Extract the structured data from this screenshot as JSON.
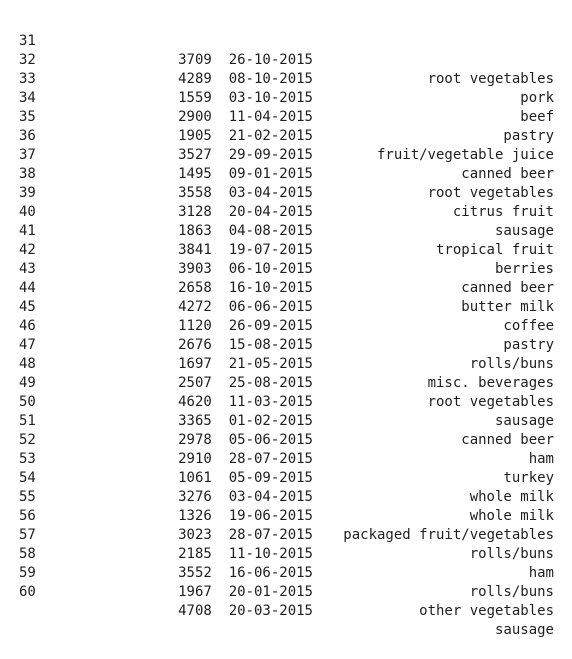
{
  "rows": [
    {
      "index": "",
      "number": "",
      "date": "",
      "item": "vegetables"
    },
    {
      "index": "31",
      "number": "3709",
      "date": "26-10-2015",
      "item": "root vegetables"
    },
    {
      "index": "32",
      "number": "4289",
      "date": "08-10-2015",
      "item": "pork"
    },
    {
      "index": "33",
      "number": "1559",
      "date": "03-10-2015",
      "item": "beef"
    },
    {
      "index": "34",
      "number": "2900",
      "date": "11-04-2015",
      "item": "pastry"
    },
    {
      "index": "35",
      "number": "1905",
      "date": "21-02-2015",
      "item": "fruit/vegetable juice"
    },
    {
      "index": "36",
      "number": "3527",
      "date": "29-09-2015",
      "item": "canned beer"
    },
    {
      "index": "37",
      "number": "1495",
      "date": "09-01-2015",
      "item": "root vegetables"
    },
    {
      "index": "38",
      "number": "3558",
      "date": "03-04-2015",
      "item": "citrus fruit"
    },
    {
      "index": "39",
      "number": "3128",
      "date": "20-04-2015",
      "item": "sausage"
    },
    {
      "index": "40",
      "number": "1863",
      "date": "04-08-2015",
      "item": "tropical fruit"
    },
    {
      "index": "41",
      "number": "3841",
      "date": "19-07-2015",
      "item": "berries"
    },
    {
      "index": "42",
      "number": "3903",
      "date": "06-10-2015",
      "item": "canned beer"
    },
    {
      "index": "43",
      "number": "2658",
      "date": "16-10-2015",
      "item": "butter milk"
    },
    {
      "index": "44",
      "number": "4272",
      "date": "06-06-2015",
      "item": "coffee"
    },
    {
      "index": "45",
      "number": "1120",
      "date": "26-09-2015",
      "item": "pastry"
    },
    {
      "index": "46",
      "number": "2676",
      "date": "15-08-2015",
      "item": "rolls/buns"
    },
    {
      "index": "47",
      "number": "1697",
      "date": "21-05-2015",
      "item": "misc. beverages"
    },
    {
      "index": "48",
      "number": "2507",
      "date": "25-08-2015",
      "item": "root vegetables"
    },
    {
      "index": "49",
      "number": "4620",
      "date": "11-03-2015",
      "item": "sausage"
    },
    {
      "index": "50",
      "number": "3365",
      "date": "01-02-2015",
      "item": "canned beer"
    },
    {
      "index": "51",
      "number": "2978",
      "date": "05-06-2015",
      "item": "ham"
    },
    {
      "index": "52",
      "number": "2910",
      "date": "28-07-2015",
      "item": "turkey"
    },
    {
      "index": "53",
      "number": "1061",
      "date": "05-09-2015",
      "item": "whole milk"
    },
    {
      "index": "54",
      "number": "3276",
      "date": "03-04-2015",
      "item": "whole milk"
    },
    {
      "index": "55",
      "number": "1326",
      "date": "19-06-2015",
      "item": "packaged fruit/vegetables"
    },
    {
      "index": "56",
      "number": "3023",
      "date": "28-07-2015",
      "item": "rolls/buns"
    },
    {
      "index": "57",
      "number": "2185",
      "date": "11-10-2015",
      "item": "ham"
    },
    {
      "index": "58",
      "number": "3552",
      "date": "16-06-2015",
      "item": "rolls/buns"
    },
    {
      "index": "59",
      "number": "1967",
      "date": "20-01-2015",
      "item": "other vegetables"
    },
    {
      "index": "60",
      "number": "4708",
      "date": "20-03-2015",
      "item": "sausage"
    }
  ]
}
